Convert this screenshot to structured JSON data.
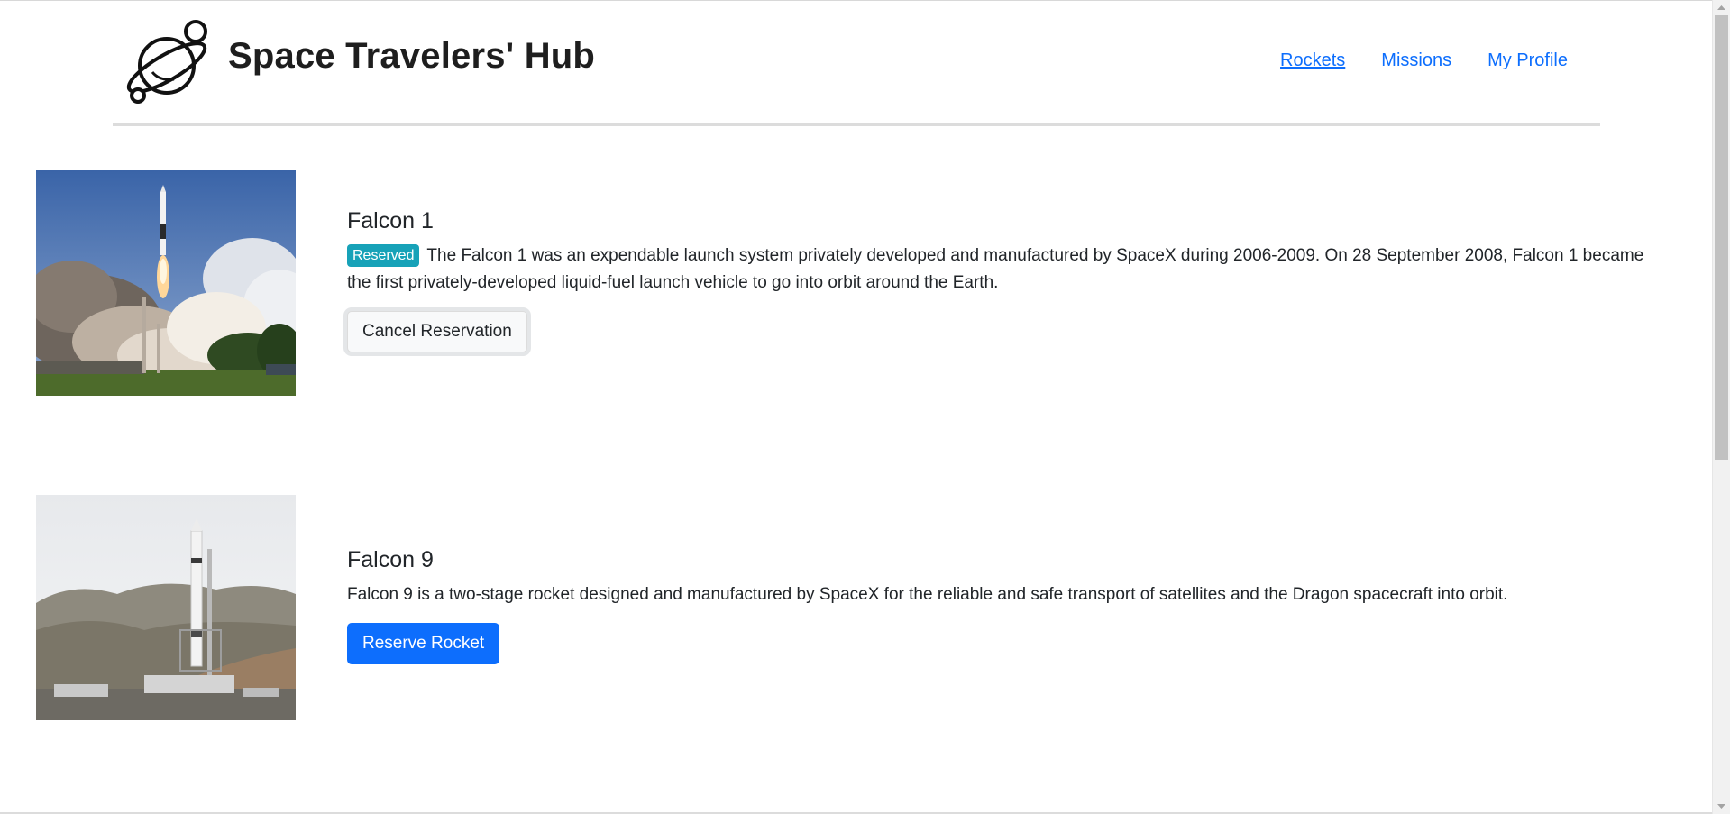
{
  "header": {
    "title": "Space Travelers' Hub",
    "logo_icon": "planet-icon",
    "nav": [
      {
        "label": "Rockets",
        "active": true
      },
      {
        "label": "Missions",
        "active": false
      },
      {
        "label": "My Profile",
        "active": false
      }
    ]
  },
  "rockets": [
    {
      "name": "Falcon 1",
      "reserved": true,
      "badge": "Reserved",
      "description": "The Falcon 1 was an expendable launch system privately developed and manufactured by SpaceX during 2006-2009. On 28 September 2008, Falcon 1 became the first privately-developed liquid-fuel launch vehicle to go into orbit around the Earth.",
      "button": "Cancel Reservation",
      "image": "falcon-1-launch-photo"
    },
    {
      "name": "Falcon 9",
      "reserved": false,
      "description": "Falcon 9 is a two-stage rocket designed and manufactured by SpaceX for the reliable and safe transport of satellites and the Dragon spacecraft into orbit.",
      "button": "Reserve Rocket",
      "image": "falcon-9-pad-photo"
    }
  ],
  "colors": {
    "link": "#0d6efd",
    "badge": "#17a2b8",
    "primary": "#0d6efd"
  }
}
